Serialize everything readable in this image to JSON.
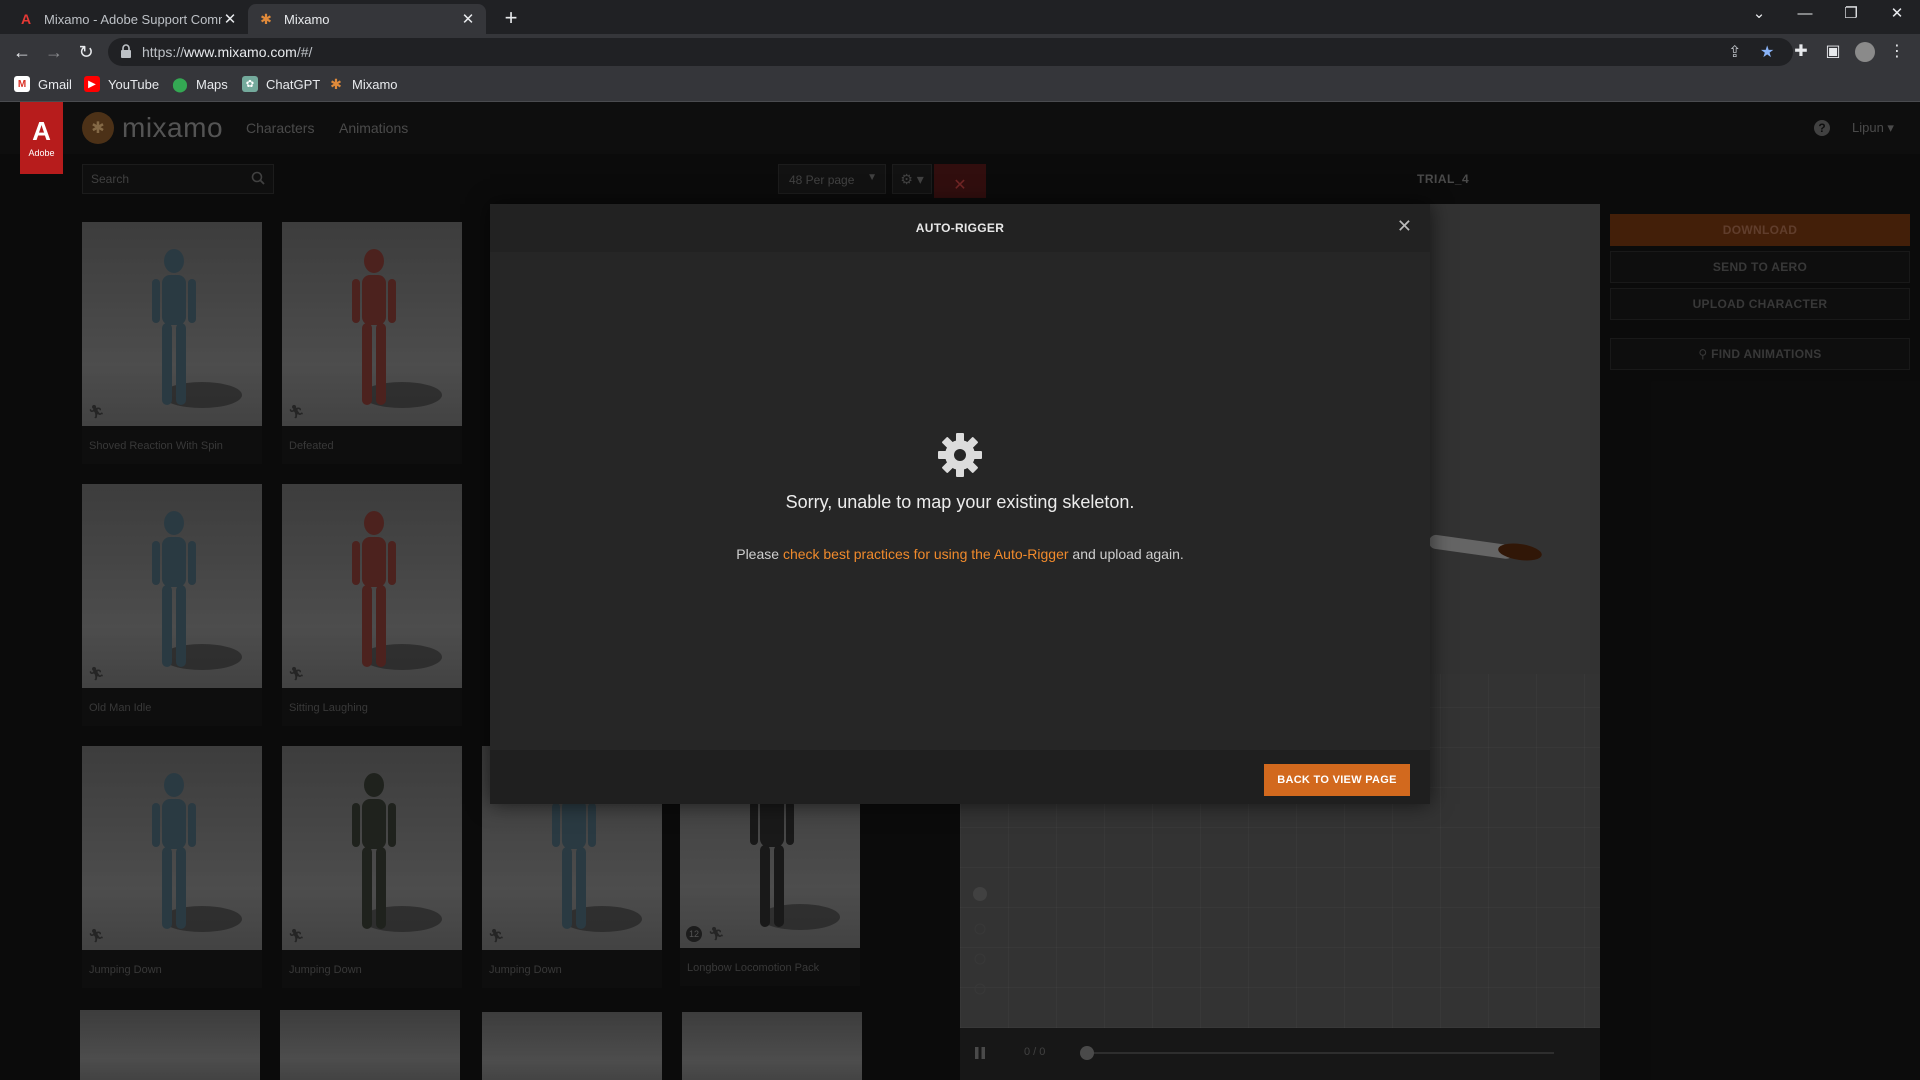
{
  "browser": {
    "tabs": [
      {
        "title": "Mixamo - Adobe Support Comm",
        "active": false
      },
      {
        "title": "Mixamo",
        "active": true
      }
    ],
    "url_prefix": "https://",
    "url_host": "www.mixamo.com",
    "url_path": "/#/",
    "bookmarks": [
      "Gmail",
      "YouTube",
      "Maps",
      "ChatGPT",
      "Mixamo"
    ]
  },
  "header": {
    "adobe_label": "Adobe",
    "logo_text": "mixamo",
    "nav": [
      "Characters",
      "Animations"
    ],
    "user": "Lipun"
  },
  "toolbar": {
    "search_placeholder": "Search",
    "per_page": "48 Per page",
    "character_name": "TRIAL_4"
  },
  "cards": [
    {
      "label": "Shoved Reaction With Spin",
      "color": "#4e6a78"
    },
    {
      "label": "Defeated",
      "color": "#8a3e38"
    },
    {
      "label": "Old Man Idle",
      "color": "#4e6a78"
    },
    {
      "label": "Sitting Laughing",
      "color": "#8a3e38"
    },
    {
      "label": "Jumping Down",
      "color": "#4e6a78"
    },
    {
      "label": "Jumping Down",
      "color": "#3a3f35"
    },
    {
      "label": "Jumping Down",
      "color": "#4e6a78"
    },
    {
      "label": "Longbow Locomotion Pack",
      "color": "#2e2e2e",
      "badge": "12"
    }
  ],
  "viewer": {
    "frame_counter": "0 / 0"
  },
  "right_panel": {
    "download": "DOWNLOAD",
    "send_to_aero": "SEND TO AERO",
    "upload_character": "UPLOAD CHARACTER",
    "find_animations": "FIND ANIMATIONS"
  },
  "modal": {
    "title": "AUTO-RIGGER",
    "message": "Sorry, unable to map your existing skeleton.",
    "sub_prefix": "Please ",
    "sub_link": "check best practices for using the Auto-Rigger",
    "sub_suffix": " and upload again.",
    "back_button": "BACK TO VIEW PAGE"
  },
  "colors": {
    "accent": "#d2691e",
    "link": "#f08a2c",
    "adobe_red": "#b71c1c"
  }
}
